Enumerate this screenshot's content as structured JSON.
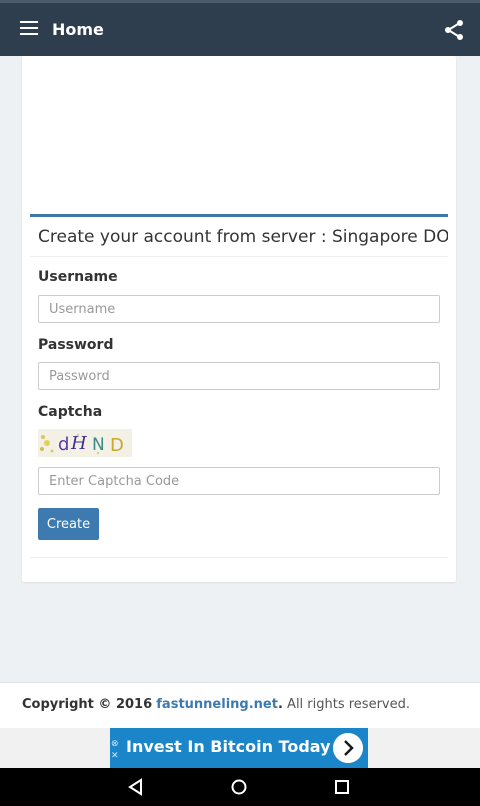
{
  "header": {
    "title": "Home",
    "menu_icon": "hamburger-menu-icon",
    "share_icon": "share-icon"
  },
  "form": {
    "heading": "Create your account from server : Singapore DO",
    "username_label": "Username",
    "username_placeholder": "Username",
    "password_label": "Password",
    "password_placeholder": "Password",
    "captcha_label": "Captcha",
    "captcha_text": "dHND",
    "captcha_placeholder": "Enter Captcha Code",
    "create_label": "Create",
    "accent_color": "#3d7ab0"
  },
  "footer": {
    "prefix": "Copyright © 2016",
    "link": "fastunneling.net",
    "suffix": "All rights reserved."
  },
  "ad": {
    "text": "Invest In Bitcoin Today",
    "marks": [
      "⊗",
      "✕"
    ]
  },
  "system_nav": {
    "icons": [
      "back-icon",
      "home-icon",
      "recents-icon"
    ]
  }
}
